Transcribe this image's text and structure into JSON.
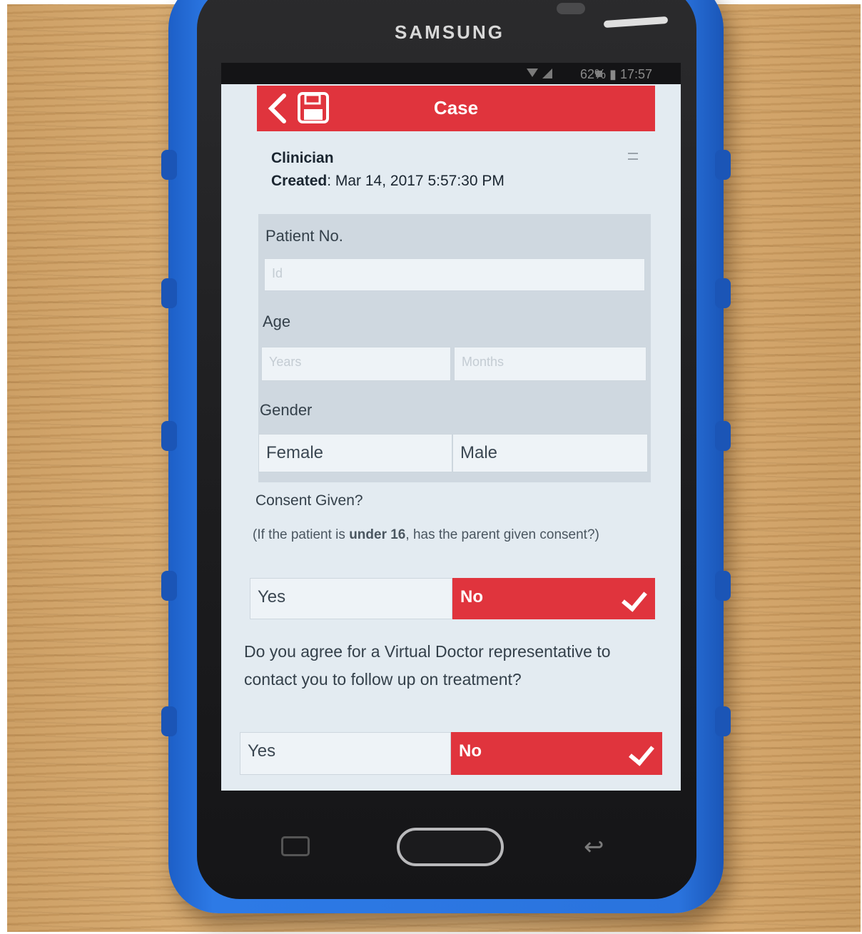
{
  "device": {
    "brand": "SAMSUNG"
  },
  "status_bar": {
    "battery_and_time": "62% ▮ 17:57"
  },
  "app_bar": {
    "title": "Case",
    "back_icon": "chevron-left-icon",
    "save_icon": "floppy-disk-icon"
  },
  "case_info": {
    "clinician_label": "Clinician",
    "created_label": "Created",
    "created_value": ": Mar 14, 2017 5:57:30 PM"
  },
  "patient_no": {
    "label": "Patient No.",
    "placeholder": "Id"
  },
  "age": {
    "label": "Age",
    "years_placeholder": "Years",
    "months_placeholder": "Months"
  },
  "gender": {
    "label": "Gender",
    "options": [
      "Female",
      "Male"
    ]
  },
  "consent": {
    "question": "Consent Given?",
    "note_before": "(If the patient is ",
    "note_bold": "under 16",
    "note_after": ", has the parent given consent?)",
    "options": [
      "Yes",
      "No"
    ],
    "selected": "No"
  },
  "follow_up": {
    "question": "Do you agree for a Virtual Doctor representative to contact you to follow up on treatment?",
    "options": [
      "Yes",
      "No"
    ],
    "selected": "No"
  },
  "colors": {
    "accent": "#e0343d",
    "case": "#2a73dd",
    "screen_bg": "#e3ebf1"
  }
}
